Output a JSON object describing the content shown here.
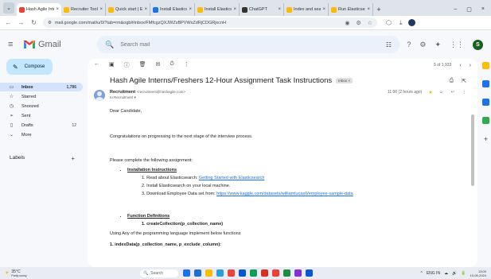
{
  "browser": {
    "tabs": [
      {
        "label": "Hash Agile Inter",
        "color": "#ea4335",
        "active": true
      },
      {
        "label": "Recruiter Tools",
        "color": "#fbbc04",
        "active": false
      },
      {
        "label": "Quick start | Ela",
        "color": "#fbbc04",
        "active": false
      },
      {
        "label": "Install Elastics",
        "color": "#1a73e8",
        "active": false
      },
      {
        "label": "Install Elastics",
        "color": "#fbbc04",
        "active": false
      },
      {
        "label": "ChatGPT",
        "color": "#333333",
        "active": false
      },
      {
        "label": "Index and search",
        "color": "#fbbc04",
        "active": false
      },
      {
        "label": "Run Elasticsear",
        "color": "#fbbc04",
        "active": false
      }
    ],
    "url": "mail.google.com/mail/u/0/?tab=rm&ogbl#inbox/FMfcgzQXJWZxBPVWxZdRjCDGRjxcnH",
    "close_glyph": "×",
    "new_tab_glyph": "+",
    "menu_glyph": "⌄",
    "win_min": "–",
    "win_max": "▢",
    "win_close": "×",
    "back_glyph": "←",
    "forward_glyph": "→",
    "reload_glyph": "↻",
    "site_glyph": "⚙",
    "omni_icons": [
      "◉",
      "⚙",
      "☆"
    ],
    "tb_icons": [
      "⬡",
      "⤓"
    ]
  },
  "gmail": {
    "hamburger_glyph": "≡",
    "logo_text": "Gmail",
    "search_placeholder": "Search mail",
    "search_glyph": "🔍",
    "filter_glyph": "☷",
    "header_icons": [
      "?",
      "⚙",
      "✦",
      "⋮⋮"
    ],
    "avatar_letter": "S",
    "compose_glyph": "✎",
    "compose_label": "Compose",
    "nav": [
      {
        "icon": "▭",
        "label": "Inbox",
        "count": "1,786",
        "active": true
      },
      {
        "icon": "☆",
        "label": "Starred",
        "count": "",
        "active": false
      },
      {
        "icon": "◷",
        "label": "Snoozed",
        "count": "",
        "active": false
      },
      {
        "icon": "➢",
        "label": "Sent",
        "count": "",
        "active": false
      },
      {
        "icon": "▯",
        "label": "Drafts",
        "count": "12",
        "active": false
      },
      {
        "icon": "⌄",
        "label": "More",
        "count": "",
        "active": false
      }
    ],
    "labels_title": "Labels",
    "labels_plus": "+"
  },
  "email": {
    "toolbar_icons": [
      "←",
      "▣",
      "ⓘ",
      "🗑",
      "✉",
      "⏱",
      "⋮"
    ],
    "pager": "5 of 1,933",
    "pager_prev": "‹",
    "pager_next": "›",
    "subject": "Hash Agile Interns/Freshers 12-Hour Assignment Task Instructions",
    "inbox_chip": "Inbox ×",
    "subject_icons": [
      "⎙",
      "⇱"
    ],
    "sender_name": "Recruitment",
    "sender_email": "<recruitment@hashagile.com>",
    "sender_to": "to Recruitment ▾",
    "sent_time": "11:00 (2 hours ago)",
    "star_glyph": "★",
    "meta_icons": [
      "☺",
      "↩",
      "⋮"
    ],
    "greeting": "Dear Candidate,",
    "congrats": "Congratulations on progressing to the next stage of the interview process.",
    "complete_intro": "Please complete the following assignment:",
    "section1_title": "Installation Instructions",
    "step1_prefix": "1. Read about Elasticsearch: ",
    "step1_link": "Getting Started with Elasticsearch",
    "step2": "2. Install Elasticsearch on your local machine.",
    "step3_prefix": "3. Download Employee Data set from: ",
    "step3_link": "https://www.kaggle.com/datasets/williamlucas0/employee-sample-data",
    "section2_title": "Function Definitions",
    "fn1": "1. createCollection(p_collection_name)",
    "using_text": "Using Any of the programming language implement below functions",
    "fn2": "1. indexData(p_collection_name, p_exclude_column):"
  },
  "right_panel": {
    "icons": [
      "#fbbc04",
      "#1a73e8",
      "#1a73e8",
      "#34a853"
    ],
    "plus": "+"
  },
  "taskbar": {
    "weather_glyph": "☀",
    "weather_temp": "35°C",
    "weather_desc": "Partly sunny",
    "search_glyph": "🔍",
    "search_label": "Search",
    "apps": [
      "#1a73e8",
      "#1f6fd1",
      "#fbbc04",
      "#2d9cdb",
      "#e8453c",
      "#0b57d0",
      "#0f9d58",
      "#d93025",
      "#ea4335",
      "#1e8e3e",
      "#8430ce",
      "#0b57d0"
    ],
    "tray_glyphs": [
      "^",
      "ENG IN",
      "☁",
      "🔊",
      "🔋"
    ],
    "time": "13:00",
    "date": "10-09-2024"
  }
}
